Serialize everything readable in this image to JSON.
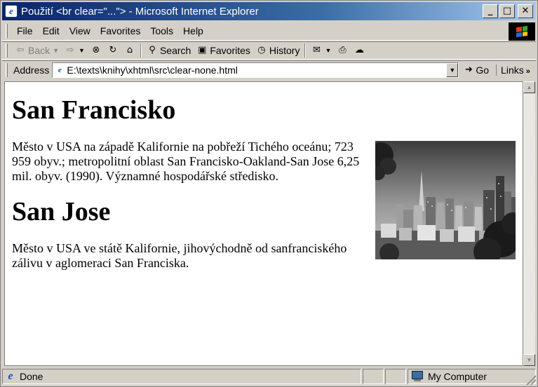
{
  "window": {
    "title": "Použití <br clear=\"...\"> - Microsoft Internet Explorer",
    "controls": {
      "minimize": "_",
      "maximize": "□",
      "close": "✕"
    }
  },
  "menu": [
    "File",
    "Edit",
    "View",
    "Favorites",
    "Tools",
    "Help"
  ],
  "toolbar": {
    "back": "Back",
    "search": "Search",
    "favorites": "Favorites",
    "history": "History"
  },
  "address": {
    "label": "Address",
    "url": "E:\\texts\\knihy\\xhtml\\src\\clear-none.html",
    "go": "Go",
    "links": "Links"
  },
  "document": {
    "heading1": "San Francisko",
    "paragraph1": "Město v USA na západě Kalifornie na pobřeží Tichého oceánu; 723 959 obyv.; metropolitní oblast San Francisko-Oakland-San Jose 6,25 mil. obyv. (1990). Významné hospodářské středisko.",
    "heading2": "San Jose",
    "paragraph2": "Město v USA ve státě Kalifornie, jihovýchodně od sanfranciského zálivu v aglomeraci San Franciska."
  },
  "status": {
    "text": "Done",
    "zone": "My Computer"
  },
  "colors": {
    "titlebar_start": "#0a246a",
    "titlebar_end": "#a6caf0",
    "chrome": "#d4d0c8",
    "page_bg": "#ffffff"
  },
  "icons": {
    "back": "back-arrow-icon",
    "forward": "forward-arrow-icon",
    "stop": "stop-icon",
    "refresh": "refresh-icon",
    "home": "home-icon",
    "search": "search-icon",
    "favorites": "favorites-icon",
    "history": "history-icon",
    "mail": "mail-icon",
    "print": "print-icon",
    "discuss": "discuss-icon"
  }
}
